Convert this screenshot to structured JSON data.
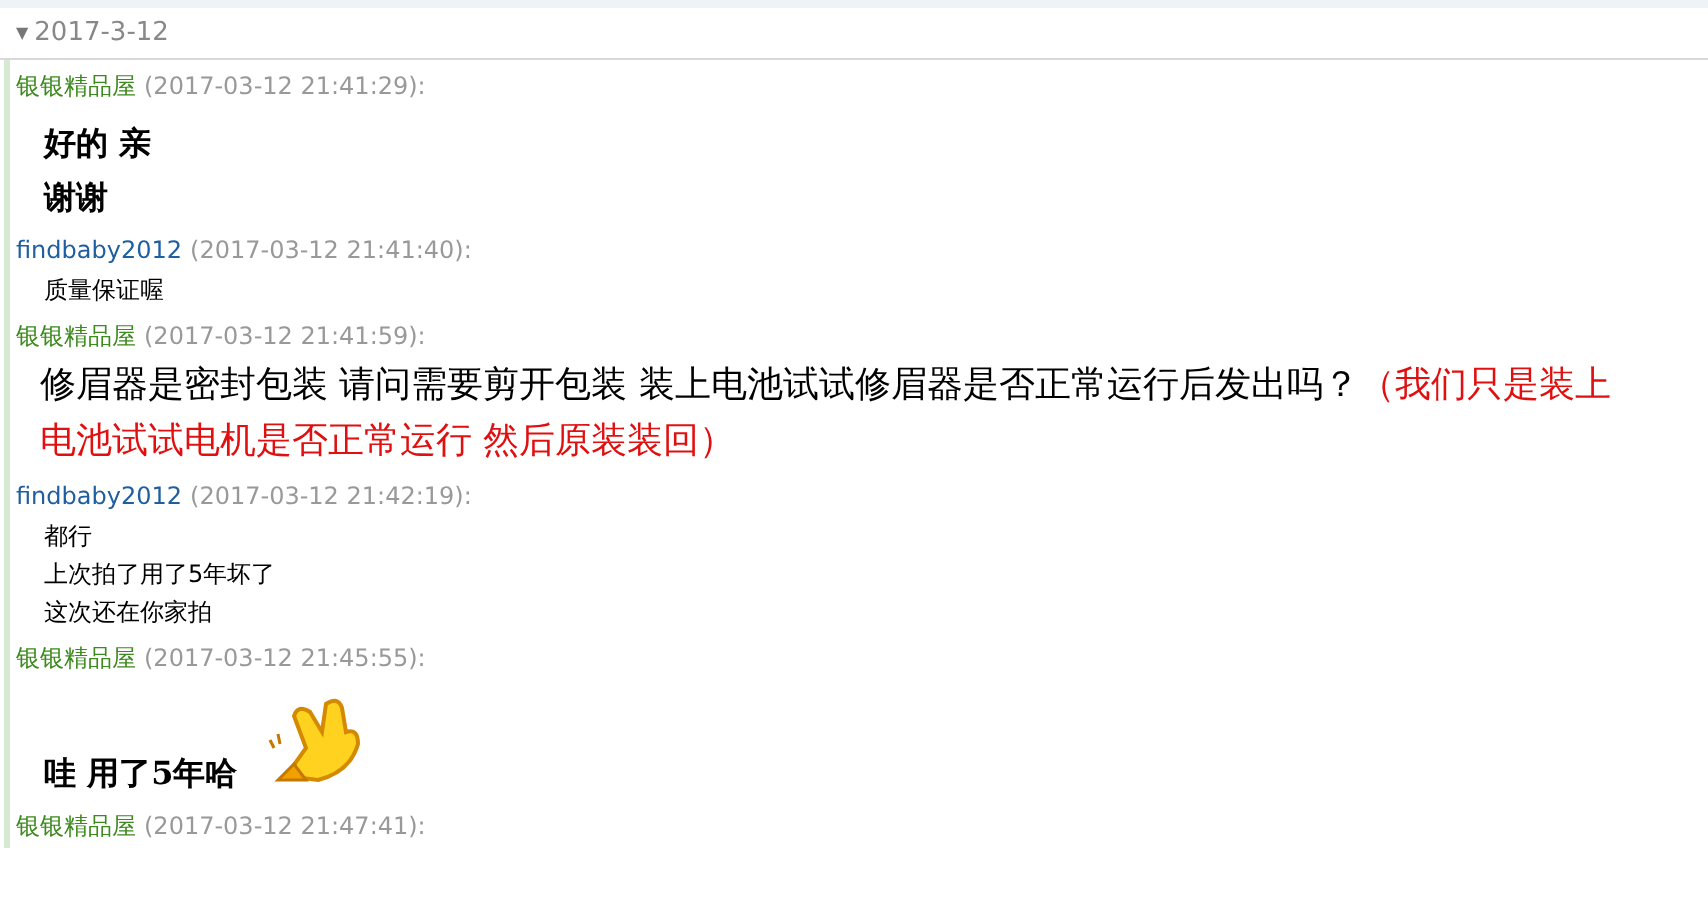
{
  "date_header": {
    "caret": "▼",
    "label": "2017-3-12"
  },
  "messages": [
    {
      "sender": "银银精品屋",
      "kind": "seller",
      "time": "(2017-03-12 21:41:29):",
      "lines": [
        {
          "kind": "bold",
          "segments": [
            {
              "text": "好的  亲",
              "emphasis": false
            }
          ]
        },
        {
          "kind": "bold",
          "segments": [
            {
              "text": "谢谢",
              "emphasis": false
            }
          ]
        }
      ]
    },
    {
      "sender": "findbaby2012",
      "kind": "buyer",
      "time": "(2017-03-12 21:41:40):",
      "lines": [
        {
          "kind": "small",
          "segments": [
            {
              "text": "质量保证喔",
              "emphasis": false
            }
          ]
        }
      ]
    },
    {
      "sender": "银银精品屋",
      "kind": "seller",
      "time": "(2017-03-12 21:41:59):",
      "lines": [
        {
          "kind": "large",
          "segments": [
            {
              "text": "修眉器是密封包装 请问需要剪开包装 装上电池试试修眉器是否正常运行后发出吗？",
              "emphasis": false
            },
            {
              "text": "（我们只是装上",
              "emphasis": true
            }
          ]
        },
        {
          "kind": "large",
          "segments": [
            {
              "text": "电池试试电机是否正常运行 然后原装装回）",
              "emphasis": true
            }
          ]
        }
      ]
    },
    {
      "sender": "findbaby2012",
      "kind": "buyer",
      "time": "(2017-03-12 21:42:19):",
      "lines": [
        {
          "kind": "small",
          "segments": [
            {
              "text": "都行",
              "emphasis": false
            }
          ]
        },
        {
          "kind": "small",
          "segments": [
            {
              "text": "上次拍了用了5年坏了",
              "emphasis": false
            }
          ]
        },
        {
          "kind": "small",
          "segments": [
            {
              "text": "这次还在你家拍",
              "emphasis": false
            }
          ]
        }
      ]
    },
    {
      "sender": "银银精品屋",
      "kind": "seller",
      "time": "(2017-03-12 21:45:55):",
      "lines": [
        {
          "kind": "bold_with_sticker",
          "segments": [
            {
              "text": "哇 用了5年哈",
              "emphasis": false
            }
          ]
        }
      ]
    },
    {
      "sender": "银银精品屋",
      "kind": "seller",
      "time": "(2017-03-12 21:47:41):"
    }
  ]
}
